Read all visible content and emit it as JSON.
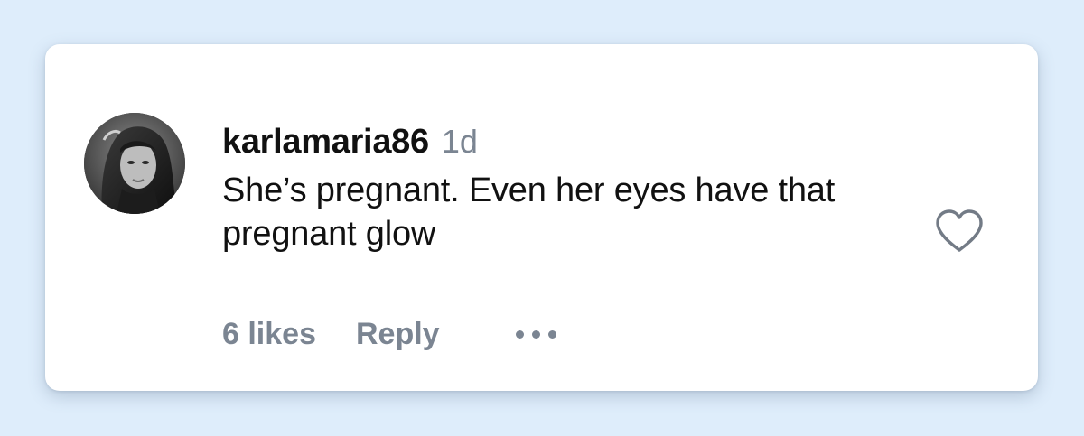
{
  "comment": {
    "avatar_icon": "user-avatar-photo",
    "username": "karlamaria86",
    "timestamp": "1d",
    "text": "She’s pregnant. Even her eyes have that pregnant glow",
    "likes_label": "6 likes",
    "reply_label": "Reply",
    "more_icon": "more-options-icon",
    "like_icon": "heart-outline-icon"
  },
  "colors": {
    "background": "#deedfb",
    "card": "#ffffff",
    "primary_text": "#111111",
    "secondary_text": "#7b8592"
  }
}
